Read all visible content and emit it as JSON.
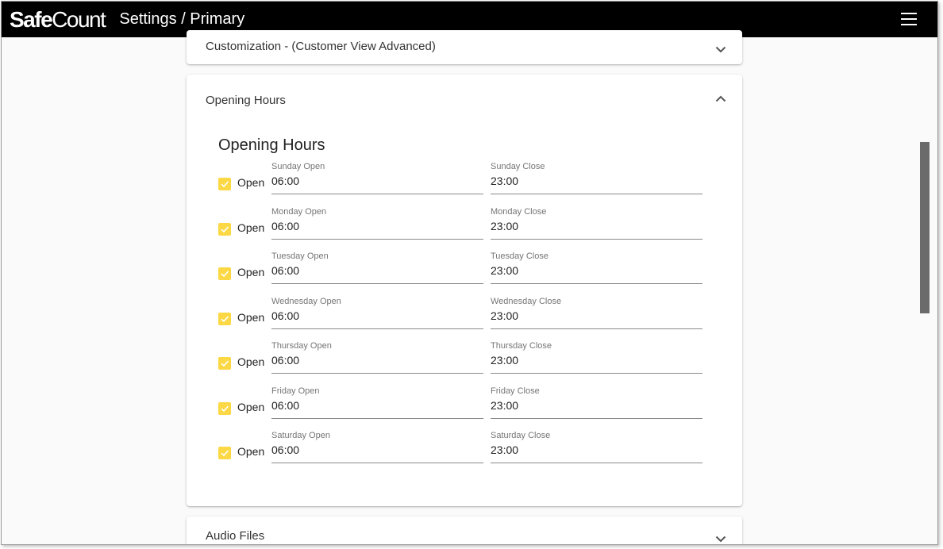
{
  "header": {
    "logo_safe": "Safe",
    "logo_count": "Count",
    "title": "Settings / Primary",
    "menu_icon": "hamburger-menu-icon",
    "background": "#000000"
  },
  "panels": {
    "customization": {
      "title": "Customization - (Customer View Advanced)",
      "expanded": false
    },
    "opening_hours": {
      "title": "Opening Hours",
      "expanded": true
    },
    "audio_files": {
      "title": "Audio Files",
      "expanded": false
    }
  },
  "opening_hours": {
    "heading": "Opening Hours",
    "checkbox_color": "#fcd845",
    "days": [
      {
        "open_checked": true,
        "open_label": "Open",
        "open_field_label": "Sunday Open",
        "open_value": "06:00",
        "close_field_label": "Sunday Close",
        "close_value": "23:00"
      },
      {
        "open_checked": true,
        "open_label": "Open",
        "open_field_label": "Monday Open",
        "open_value": "06:00",
        "close_field_label": "Monday Close",
        "close_value": "23:00"
      },
      {
        "open_checked": true,
        "open_label": "Open",
        "open_field_label": "Tuesday Open",
        "open_value": "06:00",
        "close_field_label": "Tuesday Close",
        "close_value": "23:00"
      },
      {
        "open_checked": true,
        "open_label": "Open",
        "open_field_label": "Wednesday Open",
        "open_value": "06:00",
        "close_field_label": "Wednesday Close",
        "close_value": "23:00"
      },
      {
        "open_checked": true,
        "open_label": "Open",
        "open_field_label": "Thursday Open",
        "open_value": "06:00",
        "close_field_label": "Thursday Close",
        "close_value": "23:00"
      },
      {
        "open_checked": true,
        "open_label": "Open",
        "open_field_label": "Friday Open",
        "open_value": "06:00",
        "close_field_label": "Friday Close",
        "close_value": "23:00"
      },
      {
        "open_checked": true,
        "open_label": "Open",
        "open_field_label": "Saturday Open",
        "open_value": "06:00",
        "close_field_label": "Saturday Close",
        "close_value": "23:00"
      }
    ]
  }
}
